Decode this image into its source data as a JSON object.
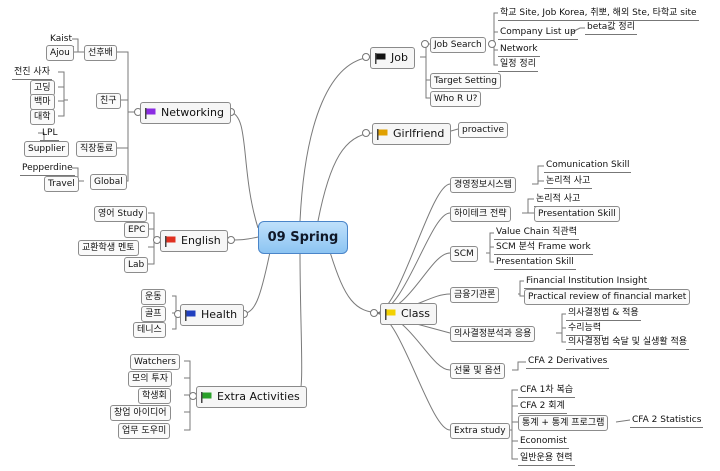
{
  "center": "09 Spring",
  "colors": {
    "job": "#111111",
    "girlfriend": "#e0a000",
    "class": "#f2d000",
    "networking": "#8a2be2",
    "english": "#e03020",
    "health": "#1f3fbf",
    "extra": "#2aa02a"
  },
  "job": {
    "label": "Job",
    "job_search": {
      "label": "Job Search",
      "item1": "학교 Site, Job Korea, 취뽀, 해외 Ste, 타학교 site",
      "company_list": "Company List up",
      "beta": "beta값 정리",
      "network": "Network",
      "schedule": "일정 정리"
    },
    "target_setting": "Target Setting",
    "who_r_u": "Who R U?"
  },
  "girlfriend": {
    "label": "Girlfriend",
    "proactive": "proactive"
  },
  "class": {
    "label": "Class",
    "mis": {
      "label": "경영정보시스템",
      "items": [
        "Comunication Skill",
        "논리적 사고"
      ]
    },
    "hitech": {
      "label": "하이테크 전략",
      "items": [
        "논리적 사고",
        "Presentation Skill"
      ]
    },
    "scm": {
      "label": "SCM",
      "items": [
        "Value Chain 직관력",
        "SCM 분석 Frame work",
        "Presentation Skill"
      ]
    },
    "finance": {
      "label": "금융기관론",
      "items": [
        "Financial Institution Insight",
        "Practical review of financial market"
      ]
    },
    "decision": {
      "label": "의사결정분석과 응용",
      "items": [
        "의사결정법 & 적용",
        "수리능력",
        "의사결정법 숙달 및 실생활 적용"
      ]
    },
    "futures": {
      "label": "선물 및 옵션",
      "items": [
        "CFA 2 Derivatives"
      ]
    },
    "extra_study": {
      "label": "Extra study",
      "items": [
        "CFA 1차 복습",
        "CFA 2 회계",
        "통계 + 통계 프로그램",
        "Economist",
        "일반운용 현력"
      ],
      "cfa_stats": "CFA 2 Statistics"
    }
  },
  "networking": {
    "label": "Networking",
    "seonhubae": {
      "label": "선후배",
      "items": [
        "Kaist",
        "Ajou"
      ]
    },
    "friends": {
      "label": "친구",
      "items": [
        "전진 사자",
        "고딩",
        "백마",
        "대학"
      ]
    },
    "colleagues": {
      "label": "직장동료",
      "items": [
        "LPL",
        "Supplier"
      ]
    },
    "global": {
      "label": "Global",
      "items": [
        "Pepperdine",
        "Travel"
      ]
    }
  },
  "english": {
    "label": "English",
    "items": [
      "영어 Study",
      "EPC",
      "교환학생 멘토",
      "Lab"
    ]
  },
  "health": {
    "label": "Health",
    "items": [
      "운동",
      "골프",
      "테니스"
    ]
  },
  "extra": {
    "label": "Extra Activities",
    "items": [
      "Watchers",
      "모의 투자",
      "학생회",
      "창업 아이디어",
      "업무 도우미"
    ]
  }
}
